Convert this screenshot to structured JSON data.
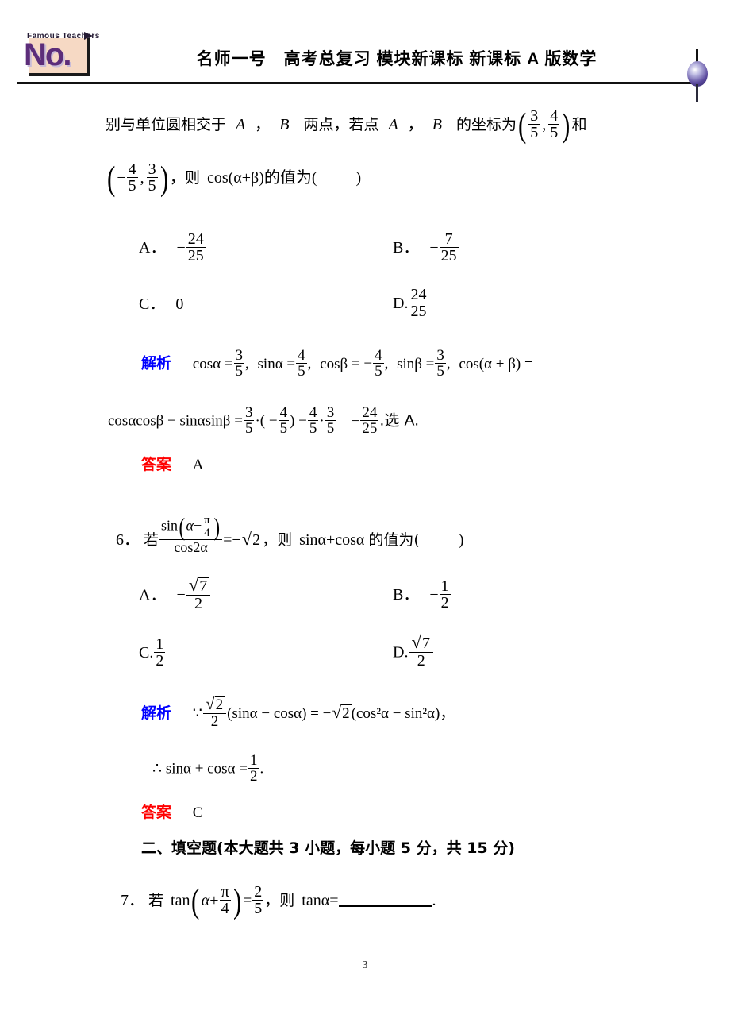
{
  "header": {
    "logo_top_text": "Famous Teachers",
    "logo_main_text": "No.",
    "title": "名师一号　高考总复习 模块新课标 新课标 A 版数学",
    "balloon_icon": "balloon-icon"
  },
  "problem5": {
    "stem_line1_a": "别与单位圆相交于",
    "stem_line1_A": "A",
    "stem_line1_comma1": "，",
    "stem_line1_B": "B",
    "stem_line1_b": "两点，若点",
    "stem_line1_A2": "A",
    "stem_line1_comma2": "，",
    "stem_line1_B2": "B",
    "stem_line1_c": "的坐标为",
    "coord1_x_num": "3",
    "coord1_x_den": "5",
    "coord1_y_num": "4",
    "coord1_y_den": "5",
    "stem_line1_he": "和",
    "coord2_x_sign": "−",
    "coord2_x_num": "4",
    "coord2_x_den": "5",
    "coord2_y_num": "3",
    "coord2_y_den": "5",
    "stem_line2_then": "，则",
    "stem_line2_expr": "cos(α+β)的值为(",
    "stem_line2_close": ")",
    "options": [
      {
        "key": "A．",
        "sign": "−",
        "num": "24",
        "den": "25"
      },
      {
        "key": "B．",
        "sign": "−",
        "num": "7",
        "den": "25"
      },
      {
        "key": "C．",
        "plain": "0"
      },
      {
        "key": "D.",
        "sign": "",
        "num": "24",
        "den": "25"
      }
    ],
    "solution_label": "解析",
    "sol_l1_cos_a": "cosα",
    "sol_l1_eq": "=",
    "sol_l1_cos_a_num": "3",
    "sol_l1_cos_a_den": "5",
    "sol_l1_sin_a": "sinα",
    "sol_l1_sin_a_num": "4",
    "sol_l1_sin_a_den": "5",
    "sol_l1_cos_b": "cosβ",
    "sol_l1_cos_b_sign": "−",
    "sol_l1_cos_b_num": "4",
    "sol_l1_cos_b_den": "5",
    "sol_l1_sin_b": "sinβ",
    "sol_l1_sin_b_num": "3",
    "sol_l1_sin_b_den": "5",
    "sol_l1_tail": "cos(α + β) =",
    "sol_l2_lhs": "cosαcosβ − sinαsinβ =",
    "sol_l2_f1_num": "3",
    "sol_l2_f1_den": "5",
    "sol_l2_dot": "·( −",
    "sol_l2_f2_num": "4",
    "sol_l2_f2_den": "5",
    "sol_l2_rparen": ") −",
    "sol_l2_f3_num": "4",
    "sol_l2_f3_den": "5",
    "sol_l2_mid": "·",
    "sol_l2_f4_num": "3",
    "sol_l2_f4_den": "5",
    "sol_l2_eq2": "= −",
    "sol_l2_f5_num": "24",
    "sol_l2_f5_den": "25",
    "sol_l2_tail": ".选 A.",
    "answer_label": "答案",
    "answer_value": "A"
  },
  "problem6": {
    "number": "6．",
    "ruo": "若",
    "num_sin": "sin",
    "num_alpha": "α",
    "num_minus": "−",
    "num_pi": "π",
    "num_four": "4",
    "den": "cos2α",
    "eq_neg": "=−",
    "sqrt_two": "2",
    "then": "，则",
    "expr": "sinα+cosα",
    "de_zhi_wei": "的值为(",
    "close": ")",
    "options": [
      {
        "key": "A．",
        "sign": "−",
        "sqrt": "7",
        "den": "2"
      },
      {
        "key": "B．",
        "sign": "−",
        "num": "1",
        "den": "2"
      },
      {
        "key": "C.",
        "sign": "",
        "num": "1",
        "den": "2"
      },
      {
        "key": "D.",
        "sign": "",
        "sqrt": "7",
        "den": "2"
      }
    ],
    "solution_label": "解析",
    "sol_l1_because": "∵",
    "sol_l1_sqrt": "2",
    "sol_l1_den": "2",
    "sol_l1_mid": "(sinα − cosα) = −",
    "sol_l1_sqrt2": "2",
    "sol_l1_tail": "(cos²α − sin²α)，",
    "sol_l2_therefore": "∴ sinα + cosα =",
    "sol_l2_num": "1",
    "sol_l2_den": "2",
    "sol_l2_dot": ".",
    "answer_label": "答案",
    "answer_value": "C"
  },
  "section2": {
    "heading": "二、填空题(本大题共 3 小题，每小题 5 分，共 15 分)"
  },
  "problem7": {
    "number": "7．",
    "ruo": "若",
    "tan": "tan",
    "alpha": "α",
    "plus": "+",
    "pi": "π",
    "four": "4",
    "eq": "=",
    "num": "2",
    "den": "5",
    "then": "，则",
    "tail": "tanα=",
    "period": "."
  },
  "footer": {
    "page_number": "3"
  },
  "colors": {
    "solution_blue": "#0000ff",
    "answer_red": "#ff0000",
    "logo_purple": "#5c2d7a"
  }
}
